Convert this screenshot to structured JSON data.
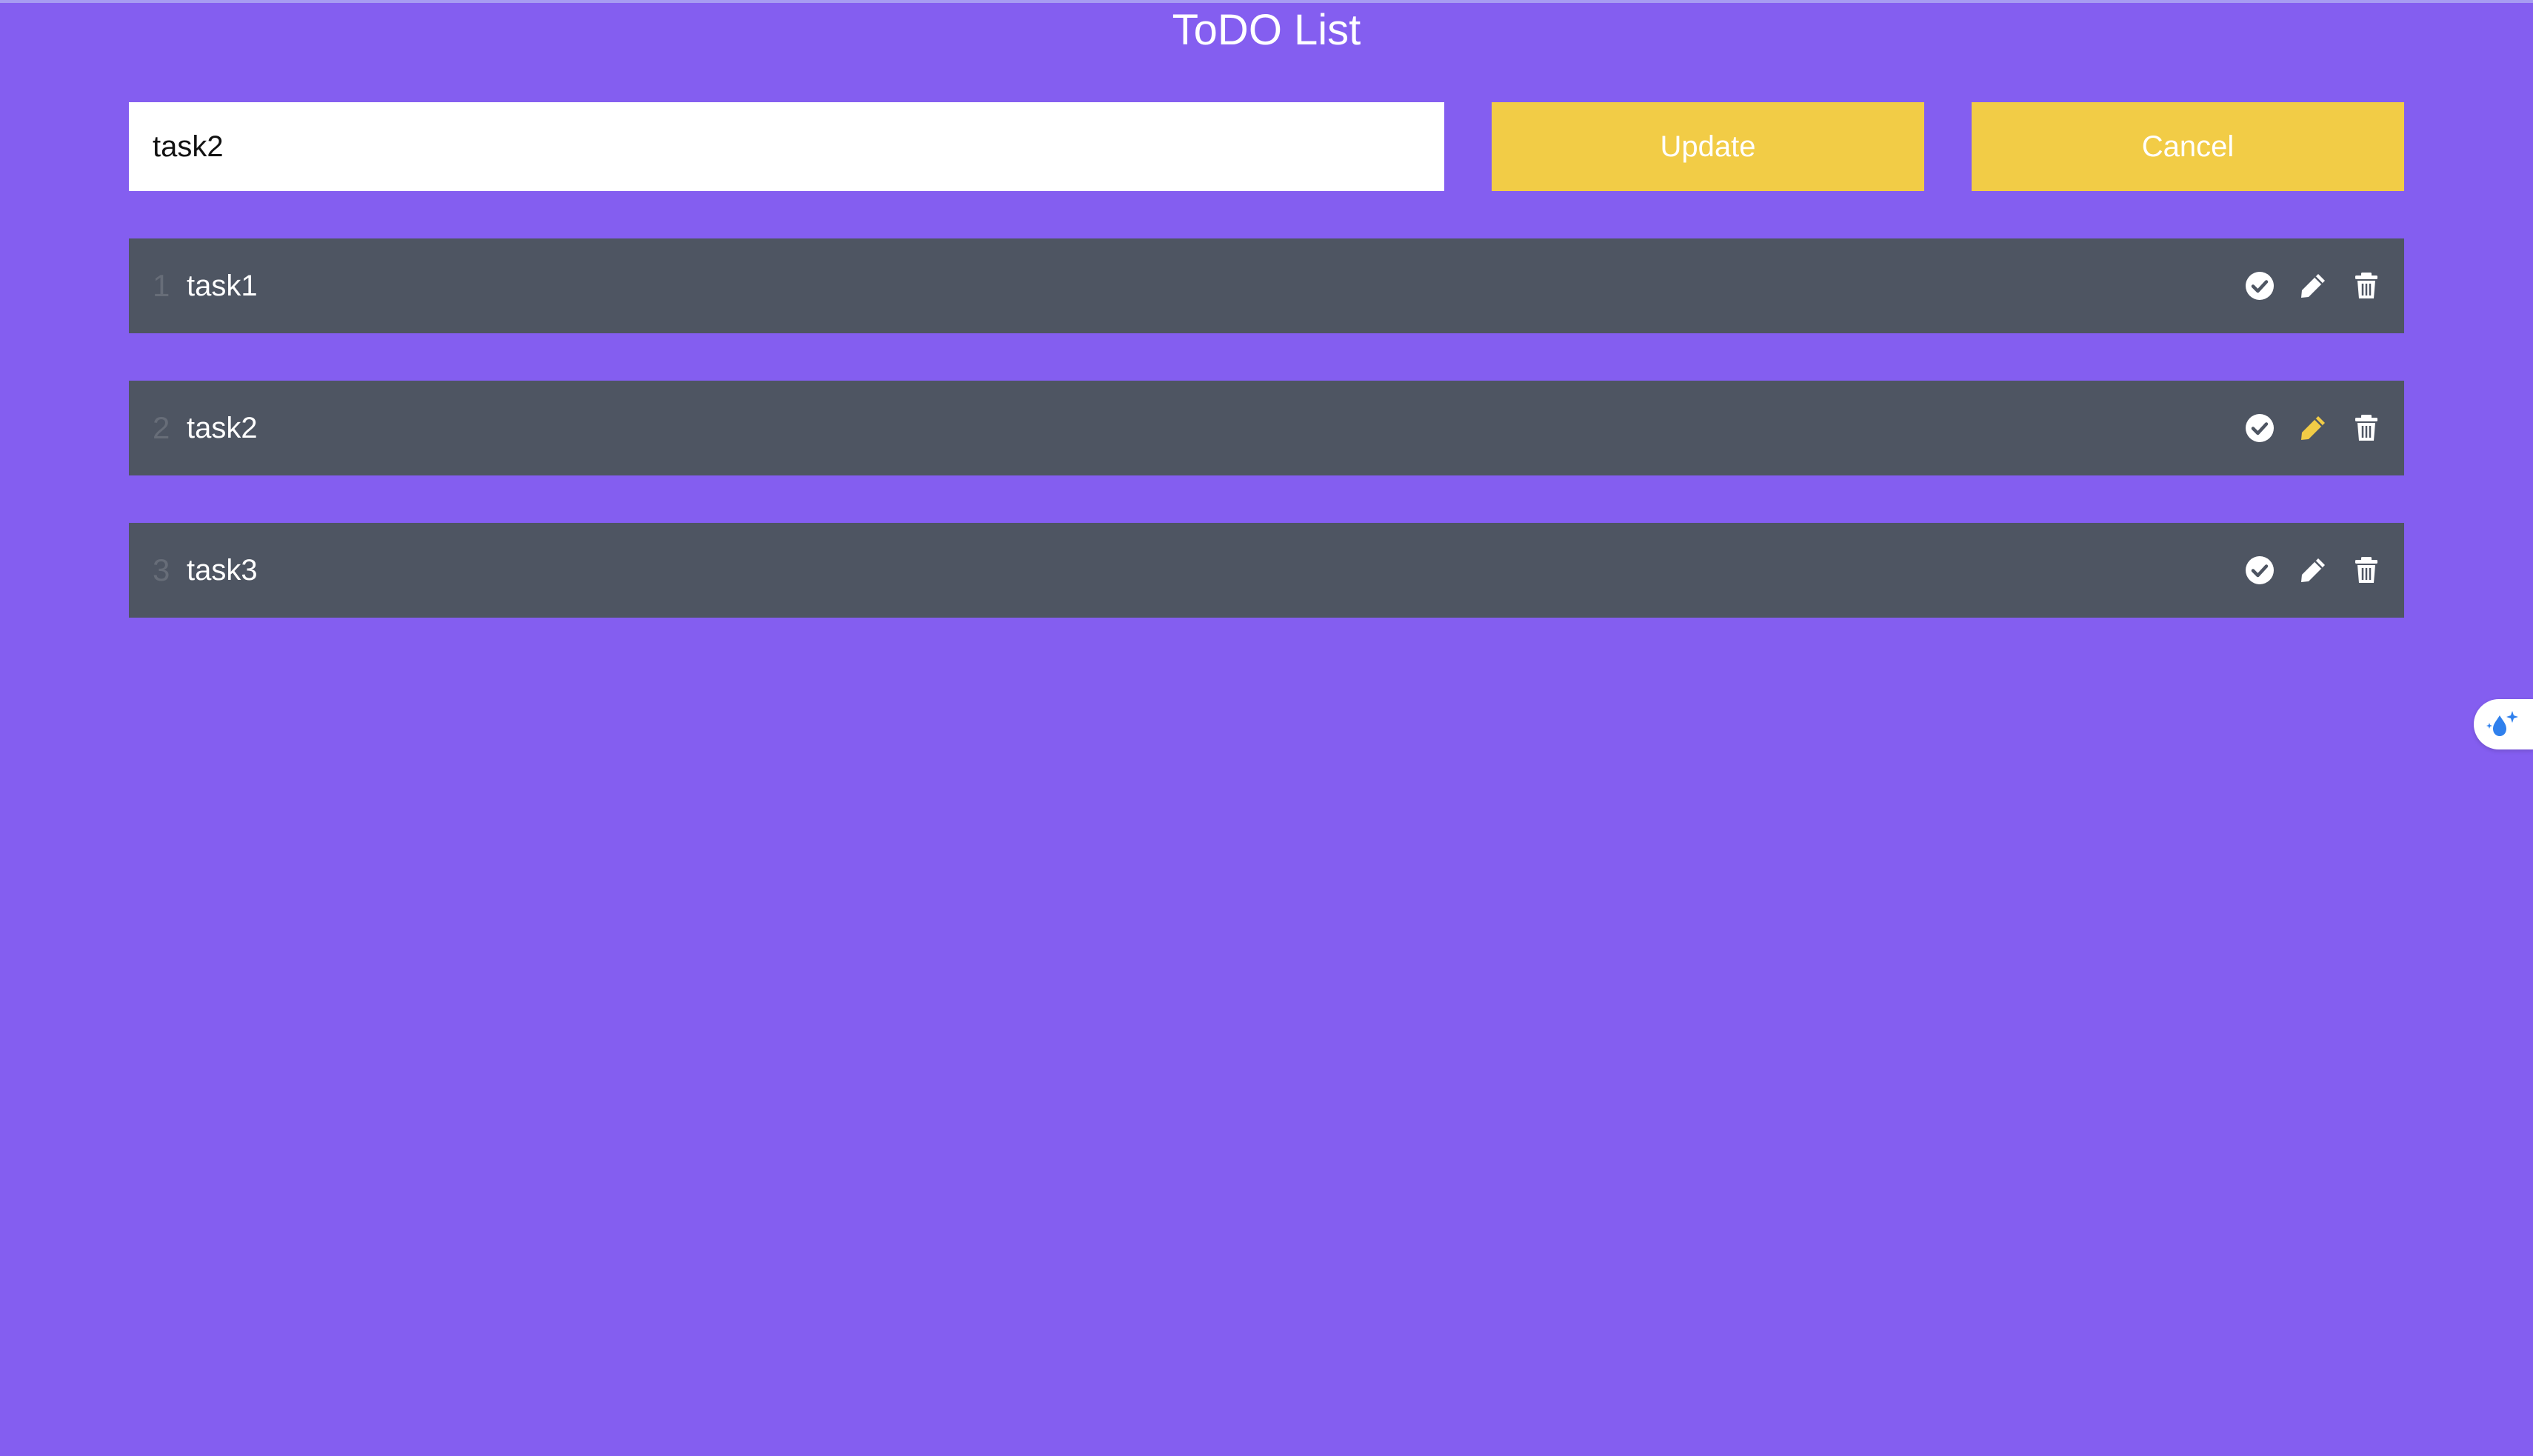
{
  "app": {
    "title": "ToDO List"
  },
  "editor": {
    "input_value": "task2",
    "update_label": "Update",
    "cancel_label": "Cancel"
  },
  "tasks": [
    {
      "number": "1",
      "text": "task1",
      "editing": false
    },
    {
      "number": "2",
      "text": "task2",
      "editing": true
    },
    {
      "number": "3",
      "text": "task3",
      "editing": false
    }
  ],
  "icons": {
    "complete": "check-circle-icon",
    "edit": "pencil-icon",
    "delete": "trash-icon",
    "side_widget": "sparkle-drop-icon"
  },
  "colors": {
    "background": "#845ef0",
    "accent": "#f2cc46",
    "row": "#4e5562",
    "text": "#ffffff",
    "muted_number": "#676d78",
    "active_edit": "#f2cc46"
  }
}
